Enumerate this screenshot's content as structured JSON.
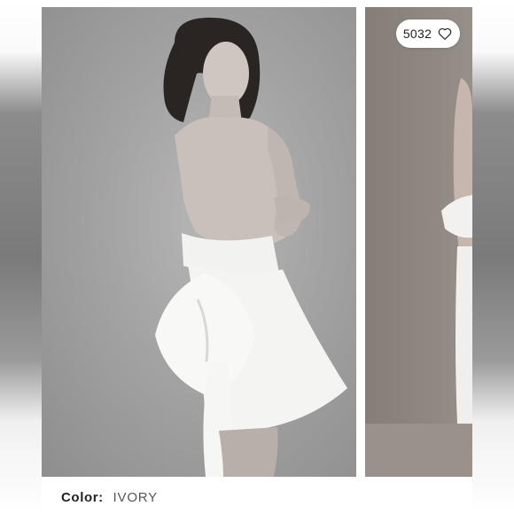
{
  "listing": {
    "like_count": "5032",
    "color_label": "Color:",
    "color_value": "IVORY"
  },
  "icons": {
    "like": "heart-outline-icon"
  },
  "colors": {
    "page_bg": "#ffffff",
    "photo_main_bg": "#a3a3a3",
    "photo_second_bg": "#8f8782",
    "dress": "#f4f4f2"
  }
}
